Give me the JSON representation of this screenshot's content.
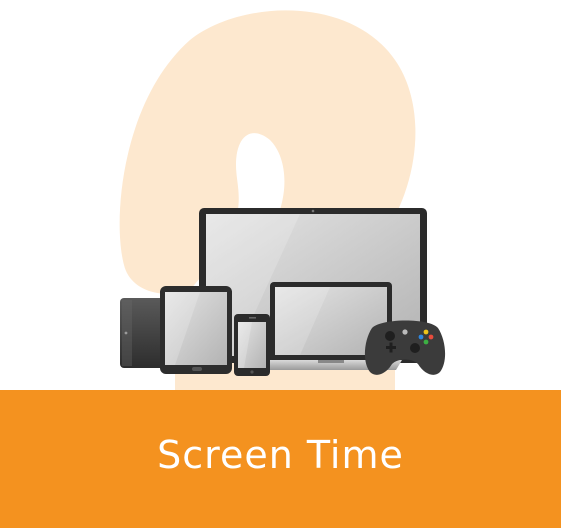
{
  "card": {
    "step_number": "2",
    "title": "Screen Time"
  },
  "colors": {
    "accent": "#F4921F",
    "numeral": "#FDE8CF",
    "title_text": "#FFFFFF"
  },
  "illustration": {
    "subject": "devices-illustration",
    "devices": [
      "monitor",
      "laptop",
      "tablet",
      "e-reader",
      "smartphone",
      "game-controller"
    ]
  }
}
